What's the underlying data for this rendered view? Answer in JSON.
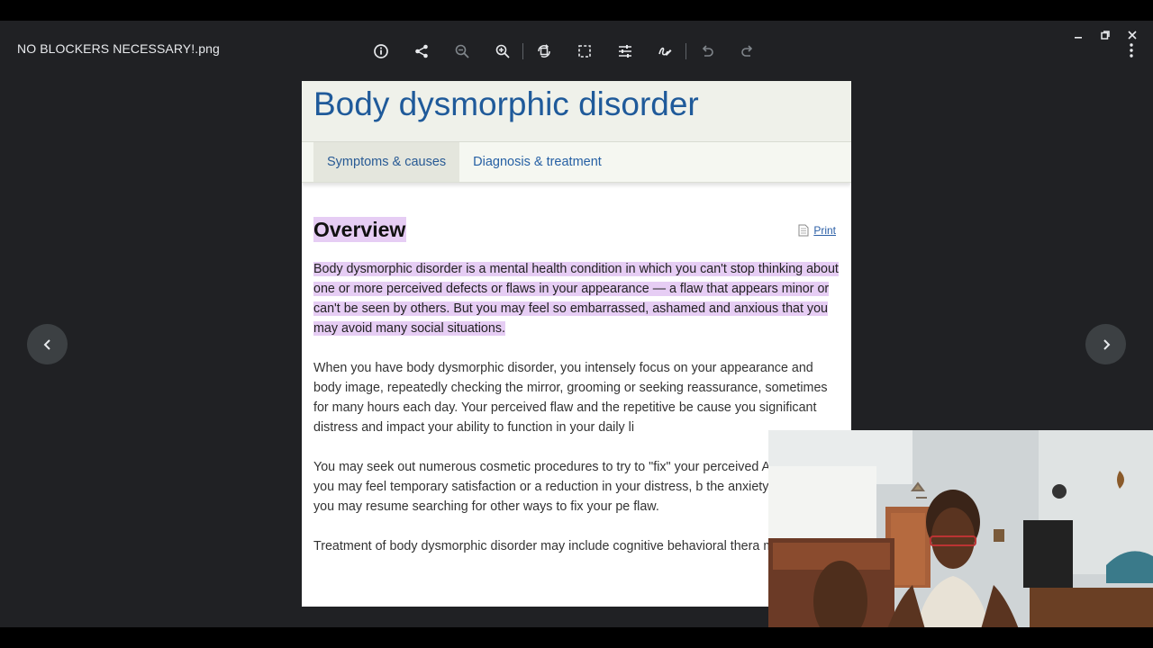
{
  "viewer": {
    "filename": "NO BLOCKERS NECESSARY!.png"
  },
  "document": {
    "title": "Body dysmorphic disorder",
    "tabs": [
      {
        "label": "Symptoms & causes",
        "active": true
      },
      {
        "label": "Diagnosis & treatment",
        "active": false
      }
    ],
    "section_heading": "Overview",
    "print_label": "Print",
    "paragraphs": [
      "Body dysmorphic disorder is a mental health condition in which you can't stop thinking about one or more perceived defects or flaws in your appearance — a flaw that appears minor or can't be seen by others. But you may feel so embarrassed, ashamed and anxious that you may avoid many social situations.",
      "When you have body dysmorphic disorder, you intensely focus on your appearance and body image, repeatedly checking the mirror, grooming or seeking reassurance, sometimes for many hours each day. Your perceived flaw and the repetitive be cause you significant distress and impact your ability to function in your daily li",
      "You may seek out numerous cosmetic procedures to try to \"fix\" your perceived Afterward, you may feel temporary satisfaction or a reduction in your distress, b the anxiety returns and you may resume searching for other ways to fix your pe flaw.",
      "Treatment of body dysmorphic disorder may include cognitive behavioral thera medication."
    ]
  },
  "colors": {
    "viewer_bg": "#202124",
    "highlight": "#e6cdf4",
    "title_blue": "#1f5a9a",
    "link_blue": "#2b5fa6"
  }
}
